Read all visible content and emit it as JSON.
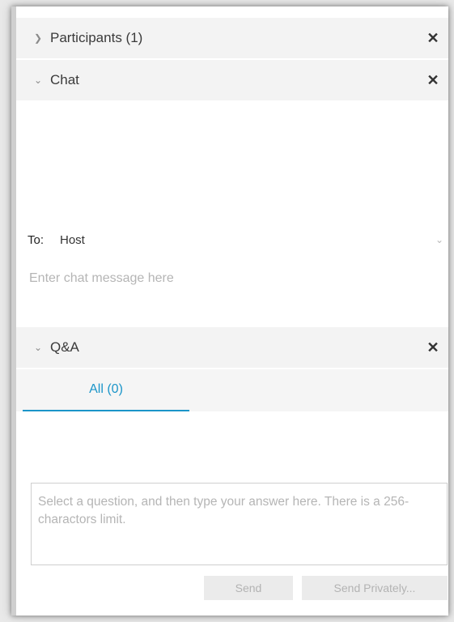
{
  "participants": {
    "title": "Participants (1)",
    "chevron": "chevron-right-icon",
    "close": "✕"
  },
  "chat": {
    "title": "Chat",
    "chevron": "chevron-down-icon",
    "close": "✕",
    "to_label": "To:",
    "to_value": "Host",
    "input_placeholder": "Enter chat message here"
  },
  "qa": {
    "title": "Q&A",
    "chevron": "chevron-down-icon",
    "close": "✕",
    "tabs": [
      {
        "label": "All (0)",
        "selected": true
      }
    ],
    "answer_placeholder": "Select a question, and then type your answer here. There is a 256-charactors limit.",
    "send_label": "Send",
    "send_privately_label": "Send Privately..."
  },
  "colors": {
    "accent": "#1b95c9",
    "header_bg": "#f3f3f3",
    "disabled_text": "#b3b3b3"
  }
}
